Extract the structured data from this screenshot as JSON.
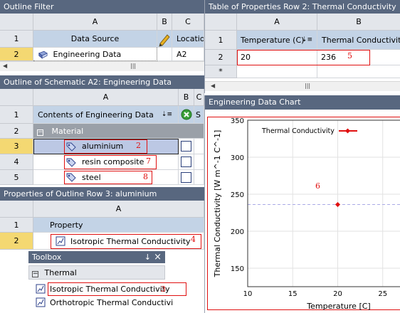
{
  "outline_filter": {
    "title": "Outline Filter",
    "col_a": "A",
    "col_b": "B",
    "col_c": "C",
    "row1_num": "1",
    "row2_num": "2",
    "header_a": "Data Source",
    "header_c": "Locatio",
    "row2_a": "Engineering Data",
    "row2_c": "A2"
  },
  "properties_table": {
    "title": "Table of Properties Row 2: Thermal Conductivity",
    "col_a": "A",
    "col_b": "B",
    "row1_num": "1",
    "row2_num": "2",
    "row3_num": "*",
    "header_a": "Temperature (C)",
    "header_b": "Thermal Conductivity (",
    "row2_a": "20",
    "row2_b": "236",
    "annotation": "5"
  },
  "schematic": {
    "title": "Outline of Schematic A2: Engineering Data",
    "col_a": "A",
    "col_b": "B",
    "col_c": "C",
    "row_nums": [
      "1",
      "2",
      "3",
      "4",
      "5"
    ],
    "header_a": "Contents of Engineering Data",
    "header_c": "S",
    "group_label": "Material",
    "items": [
      {
        "label": "aluminium",
        "annotation": "2"
      },
      {
        "label": "resin composite",
        "annotation": "7"
      },
      {
        "label": "steel",
        "annotation": "8"
      }
    ]
  },
  "chart": {
    "title": "Engineering Data Chart",
    "annotation": "6",
    "chart_data": {
      "type": "scatter",
      "title": "",
      "xlabel": "Temperature [C]",
      "ylabel": "Thermal Conductivity  [W m^-1 C^-1]",
      "xlim": [
        10,
        27
      ],
      "ylim": [
        125,
        350
      ],
      "x_ticks": [
        "10",
        "15",
        "20",
        "25"
      ],
      "y_ticks": [
        "150",
        "200",
        "250",
        "300",
        "350"
      ],
      "series": [
        {
          "name": "Thermal Conductivity",
          "color": "#e01010",
          "x": [
            20
          ],
          "y": [
            236
          ]
        }
      ],
      "grid": true,
      "legend": "top-left"
    }
  },
  "properties_outline": {
    "title": "Properties of Outline Row 3: aluminium",
    "col_a": "A",
    "row1_num": "1",
    "row2_num": "2",
    "header_a": "Property",
    "row2_a": "Isotropic Thermal Conductivity",
    "annotation": "4"
  },
  "toolbox": {
    "title": "Toolbox",
    "pin": "↓",
    "close": "×",
    "group_label": "Thermal",
    "items": [
      {
        "label": "Isotropic Thermal Conductivity",
        "annotation": "3"
      },
      {
        "label": "Orthotropic Thermal Conductivi"
      }
    ]
  },
  "colors": {
    "panel_header": "#58677f",
    "row_blue": "#c3d3e6",
    "row_selected_num": "#f4d872",
    "annotation_red": "#e01010"
  }
}
